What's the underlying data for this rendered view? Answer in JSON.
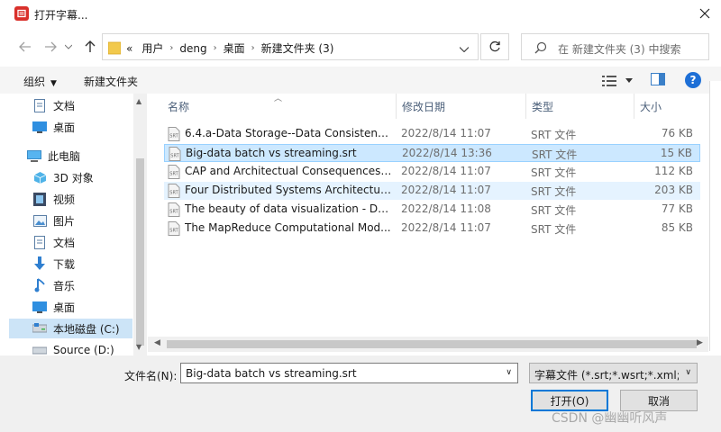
{
  "window": {
    "title": "打开字幕..."
  },
  "nav": {
    "back": "back",
    "forward": "forward",
    "up": "up"
  },
  "address": {
    "overflow": "«",
    "crumbs": [
      "用户",
      "deng",
      "桌面",
      "新建文件夹 (3)"
    ]
  },
  "search": {
    "placeholder": "在 新建文件夹 (3) 中搜索"
  },
  "toolbar": {
    "organize": "组织",
    "new_folder": "新建文件夹",
    "help": "?"
  },
  "sidebar": {
    "items": [
      {
        "label": "文档",
        "icon": "document-icon"
      },
      {
        "label": "桌面",
        "icon": "desktop-icon"
      },
      {
        "label": "此电脑",
        "icon": "computer-icon"
      },
      {
        "label": "3D 对象",
        "icon": "3d-objects-icon"
      },
      {
        "label": "视频",
        "icon": "video-icon"
      },
      {
        "label": "图片",
        "icon": "picture-icon"
      },
      {
        "label": "文档",
        "icon": "document-icon"
      },
      {
        "label": "下载",
        "icon": "download-icon"
      },
      {
        "label": "音乐",
        "icon": "music-icon"
      },
      {
        "label": "桌面",
        "icon": "desktop-icon"
      },
      {
        "label": "本地磁盘 (C:)",
        "icon": "drive-icon"
      },
      {
        "label": "Source (D:)",
        "icon": "drive-icon"
      }
    ]
  },
  "columns": {
    "name": "名称",
    "date": "修改日期",
    "type": "类型",
    "size": "大小"
  },
  "files": [
    {
      "name": "6.4.a-Data Storage--Data Consistency...",
      "date": "2022/8/14 11:07",
      "type": "SRT 文件",
      "size": "76 KB"
    },
    {
      "name": "Big-data batch vs streaming.srt",
      "date": "2022/8/14 13:36",
      "type": "SRT 文件",
      "size": "15 KB"
    },
    {
      "name": "CAP and Architectual Consequences ...",
      "date": "2022/8/14 11:07",
      "type": "SRT 文件",
      "size": "112 KB"
    },
    {
      "name": "Four Distributed Systems Architectur...",
      "date": "2022/8/14 11:07",
      "type": "SRT 文件",
      "size": "203 KB"
    },
    {
      "name": "The beauty of data visualization - Da...",
      "date": "2022/8/14 11:08",
      "type": "SRT 文件",
      "size": "77 KB"
    },
    {
      "name": "The MapReduce Computational Mod...",
      "date": "2022/8/14 11:07",
      "type": "SRT 文件",
      "size": "85 KB"
    }
  ],
  "bottom": {
    "filename_label": "文件名(N):",
    "filename_value": "Big-data batch vs streaming.srt",
    "filter_value": "字幕文件 (*.srt;*.wsrt;*.xml;*.t",
    "open_label": "打开(O)",
    "cancel_label": "取消"
  },
  "watermark": "CSDN @幽幽听风声",
  "colors": {
    "selection": "#cce8ff",
    "accent": "#0078d7",
    "app_icon": "#d9302b"
  }
}
